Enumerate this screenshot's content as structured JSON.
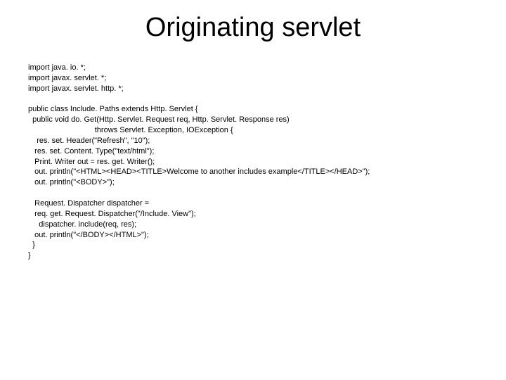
{
  "title": "Originating servlet",
  "code": "import java. io. *;\nimport javax. servlet. *;\nimport javax. servlet. http. *;\n\npublic class Include. Paths extends Http. Servlet {\n  public void do. Get(Http. Servlet. Request req, Http. Servlet. Response res)\n                               throws Servlet. Exception, IOException {\n    res. set. Header(\"Refresh\", \"10\");\n   res. set. Content. Type(\"text/html\");\n   Print. Writer out = res. get. Writer();\n   out. println(\"<HTML><HEAD><TITLE>Welcome to another includes example</TITLE></HEAD>\");\n   out. println(\"<BODY>\");\n\n   Request. Dispatcher dispatcher =\n   req. get. Request. Dispatcher(\"/Include. View\");\n     dispatcher. include(req, res);\n   out. println(\"</BODY></HTML>\");\n  }\n}"
}
